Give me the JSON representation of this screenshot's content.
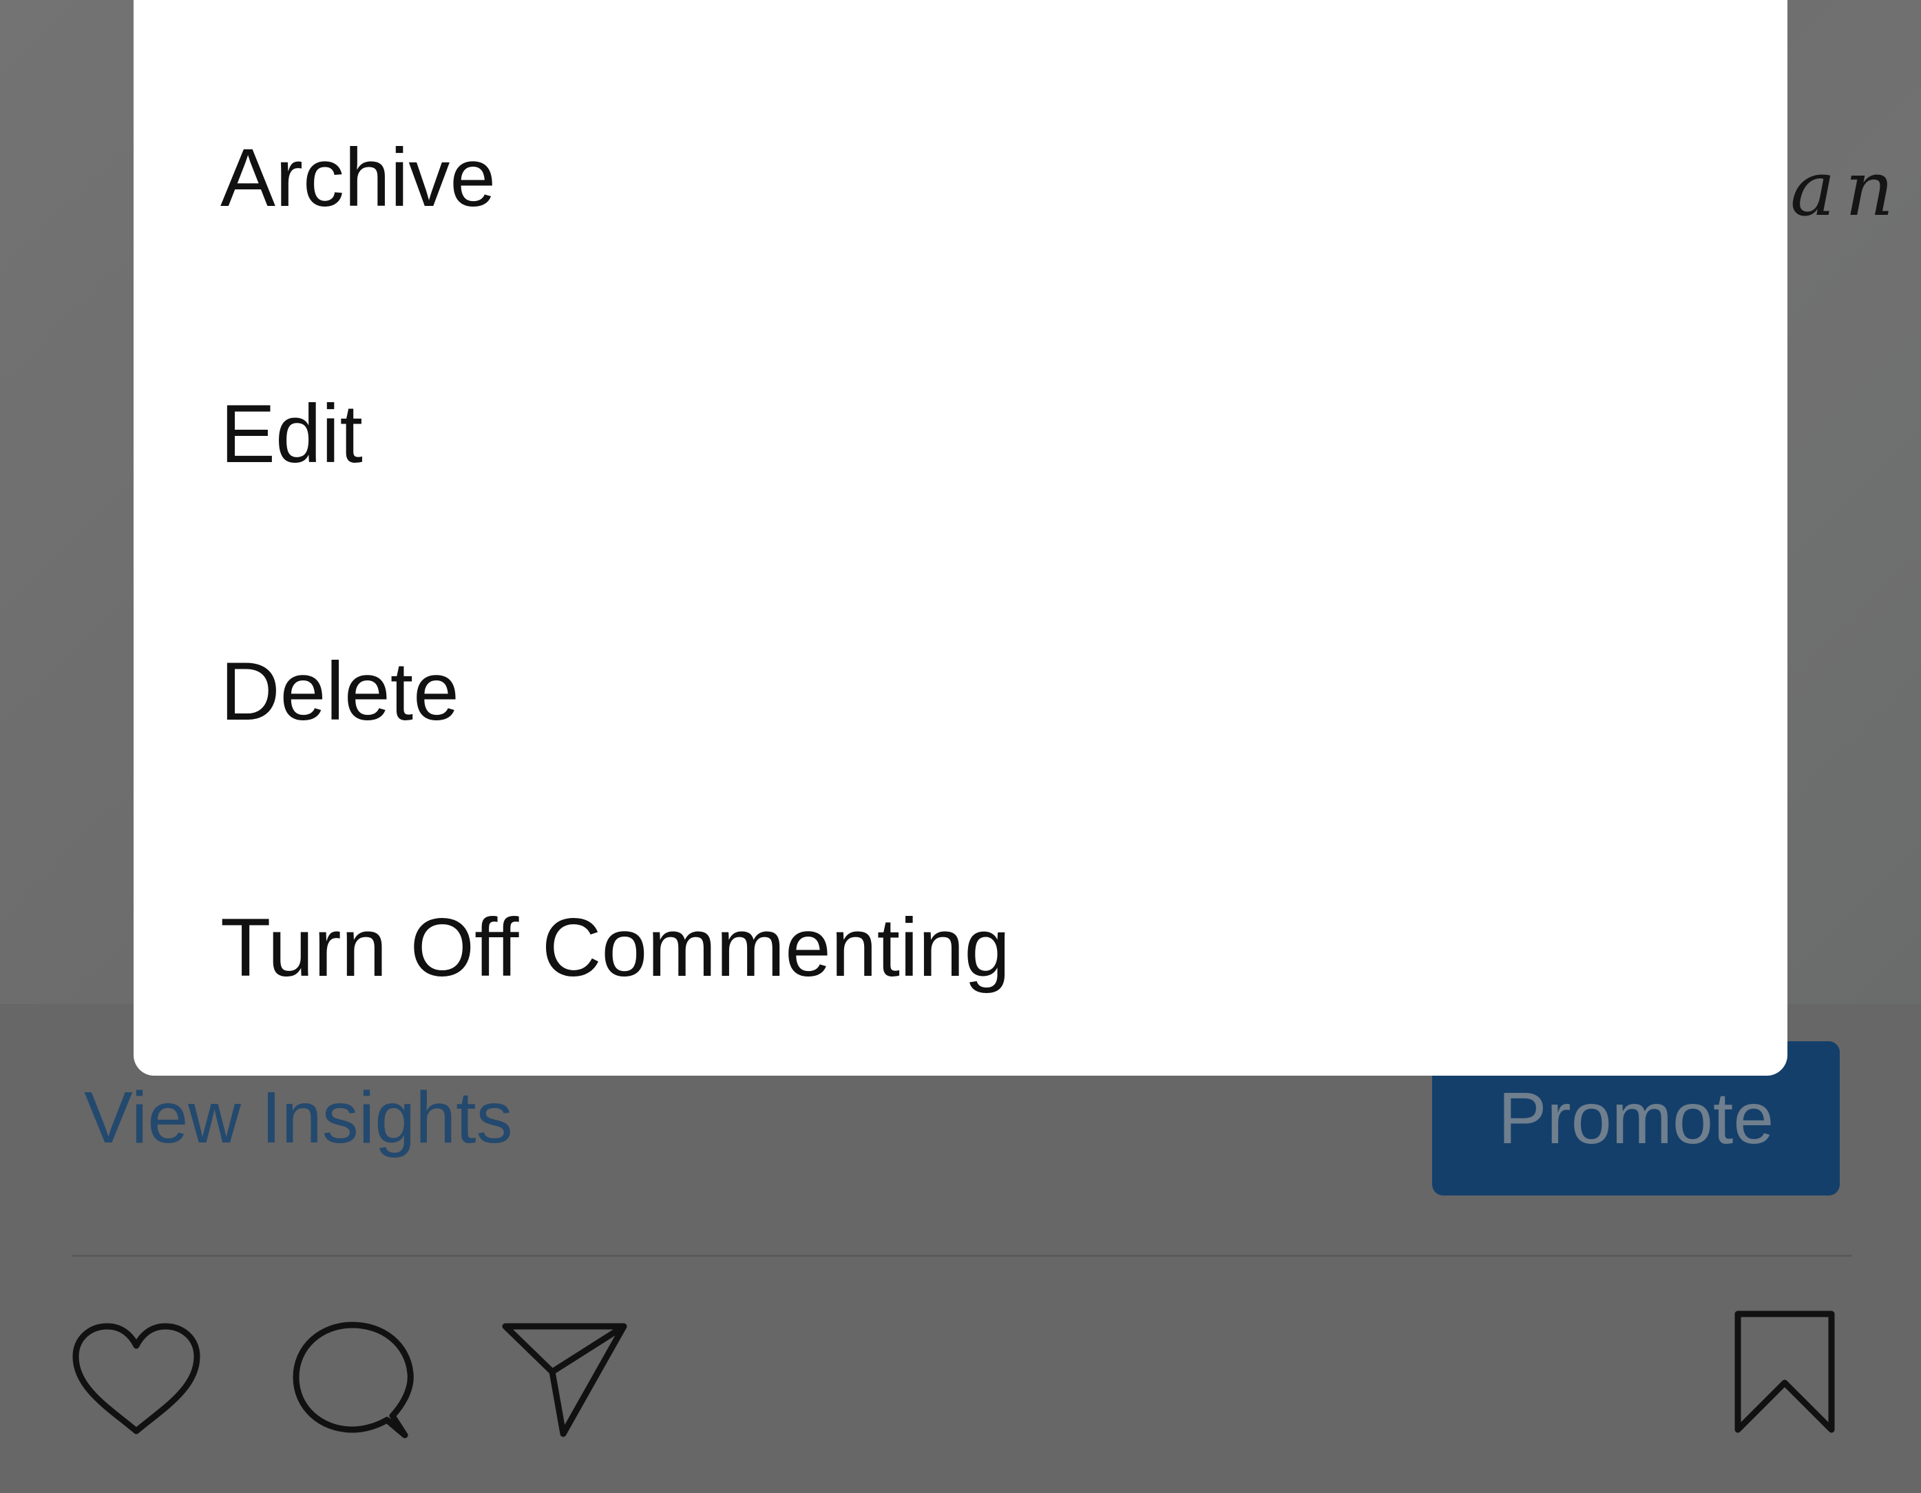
{
  "post": {
    "photo_script_text": "an"
  },
  "menu": {
    "items": [
      {
        "label": "Archive"
      },
      {
        "label": "Edit"
      },
      {
        "label": "Delete"
      },
      {
        "label": "Turn Off Commenting"
      }
    ]
  },
  "insights": {
    "view_insights_label": "View Insights",
    "promote_label": "Promote"
  },
  "action_bar": {
    "icons": [
      "heart-icon",
      "comment-icon",
      "share-icon",
      "bookmark-icon"
    ]
  },
  "colors": {
    "overlay": "#676767",
    "link": "#24496e",
    "promote_bg": "#143f6a",
    "dialog_bg": "#ffffff"
  }
}
